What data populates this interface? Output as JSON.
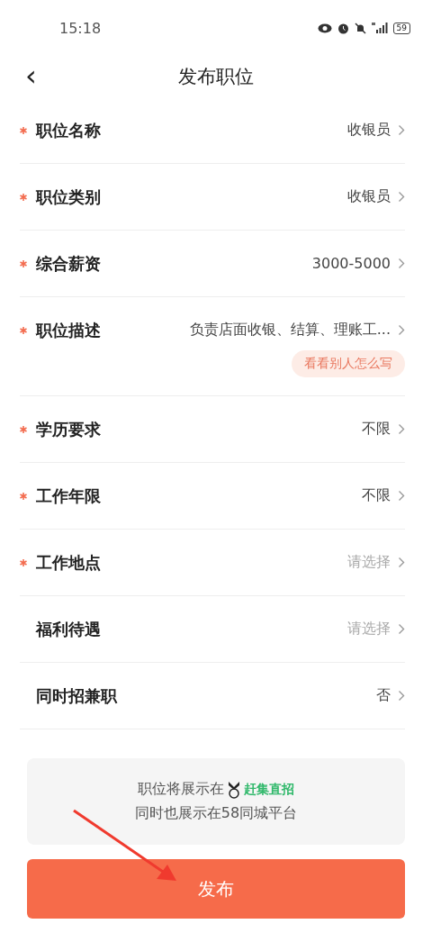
{
  "status_bar": {
    "time": "15:18",
    "battery": "59"
  },
  "header": {
    "back": "‹",
    "title": "发布职位"
  },
  "rows": [
    {
      "label": "职位名称",
      "required": true,
      "value": "收银员"
    },
    {
      "label": "职位类别",
      "required": true,
      "value": "收银员"
    },
    {
      "label": "综合薪资",
      "required": true,
      "value": "3000-5000"
    },
    {
      "label": "职位描述",
      "required": true,
      "value": "负责店面收银、结算、理账工...",
      "example_link": "看看别人怎么写"
    },
    {
      "label": "学历要求",
      "required": true,
      "value": "不限"
    },
    {
      "label": "工作年限",
      "required": true,
      "value": "不限"
    },
    {
      "label": "工作地点",
      "required": true,
      "placeholder": "请选择"
    },
    {
      "label": "福利待遇",
      "required": false,
      "placeholder": "请选择"
    },
    {
      "label": "同时招兼职",
      "required": false,
      "value": "否"
    }
  ],
  "notice": {
    "line_1": "职位将展示在",
    "brand": "赶集直招",
    "line_2": "同时也展示在58同城平台"
  },
  "publish_button": "发布"
}
